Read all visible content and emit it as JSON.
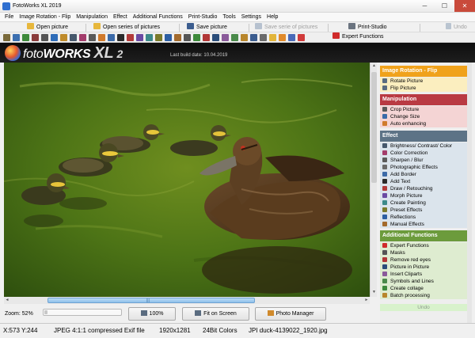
{
  "window": {
    "title": "FotoWorks XL 2019",
    "min_glyph": "─",
    "max_glyph": "☐",
    "close_glyph": "✕"
  },
  "menu": {
    "items": [
      "File",
      "Image Rotation - Flip",
      "Manipulation",
      "Effect",
      "Additional Functions",
      "Print-Studio",
      "Tools",
      "Settings",
      "Help"
    ]
  },
  "commands": {
    "open_picture": "Open picture",
    "open_series": "Open series of pictures",
    "save_picture": "Save picture",
    "save_series": "Save serie of pictures",
    "print_studio": "Print-Studio",
    "undo": "Undo",
    "expert_functions": "Expert Functions"
  },
  "banner": {
    "logo_foto": "foto",
    "logo_works": "WORKS",
    "logo_xl": "XL",
    "logo_version": "2",
    "build_date": "Last build date: 10.04.2019"
  },
  "scrollbar": {
    "grip": "|||",
    "up": "▲",
    "down": "▼",
    "left": "◄",
    "right": "►"
  },
  "controls": {
    "zoom_label": "Zoom: 52%",
    "zoom_percent": 52,
    "btn_100": "100%",
    "btn_fit": "Fit on Screen",
    "btn_photo_manager": "Photo Manager"
  },
  "status": {
    "coords": "X:573 Y:244",
    "format": "JPEG 4:1:1 compressed Exif file",
    "dimensions": "1920x1281",
    "colors": "24Bit Colors",
    "filename": "JPI duck-4139022_1920.jpg"
  },
  "sidebar": {
    "groups": [
      {
        "title": "Image Rotation - Flip",
        "header_color": "#f0a21b",
        "item_bg": "#fbeebf",
        "items": [
          "Rotate Picture",
          "Flip Picture"
        ]
      },
      {
        "title": "Manipulation",
        "header_color": "#b93a43",
        "item_bg": "#f4d4d4",
        "items": [
          "Crop Picture",
          "Change Size",
          "Auto enhancing"
        ]
      },
      {
        "title": "Effect",
        "header_color": "#5d7386",
        "item_bg": "#dbe4ec",
        "items": [
          "Brightness/ Contrast/ Color",
          "Color Correction",
          "Sharpen / Blur",
          "Photographic Effects",
          "Add Border",
          "Add Text",
          "Draw / Retouching",
          "Morph Picture",
          "Create Painting",
          "Preset Effects",
          "Reflections",
          "Manual Effects"
        ]
      },
      {
        "title": "Additional Functions",
        "header_color": "#6c9b3c",
        "item_bg": "#deecd0",
        "items": [
          "Expert Functions",
          "Masks",
          "Remove red eyes",
          "Picture in Picture",
          "Insert Cliparts",
          "Symbols and Lines",
          "Create collage",
          "Batch processing"
        ]
      }
    ],
    "undo": "Undo"
  },
  "colors": {
    "banner_bg": "#141414",
    "scroll_thumb": "#8ec0ea",
    "water_green": "#3a6b12"
  }
}
